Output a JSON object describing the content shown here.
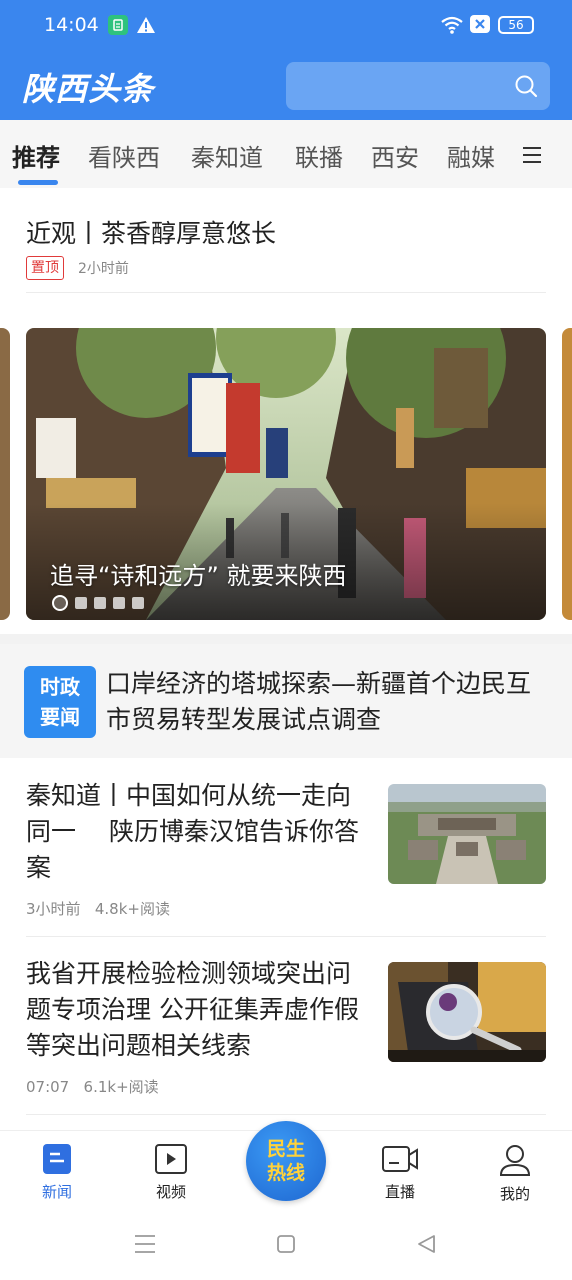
{
  "status_bar": {
    "time": "14:04",
    "battery": "56",
    "sim_label": "x"
  },
  "header": {
    "logo": "陕西头条",
    "search_placeholder": ""
  },
  "tabs": [
    {
      "label": "推荐",
      "active": true
    },
    {
      "label": "看陕西"
    },
    {
      "label": "秦知道"
    },
    {
      "label": "联播"
    },
    {
      "label": "西安"
    },
    {
      "label": "融媒"
    }
  ],
  "pinned": {
    "title": "近观丨茶香醇厚意悠长",
    "badge": "置顶",
    "time": "2小时前"
  },
  "carousel": {
    "caption": "追寻“诗和远方” 就要来陕西",
    "slide_count": 5,
    "active_index": 0
  },
  "headline": {
    "badge_line1": "时政",
    "badge_line2": "要闻",
    "title": "口岸经济的塔城探索—新疆首个边民互市贸易转型发展试点调查"
  },
  "articles": [
    {
      "title": "秦知道丨中国如何从统一走向同一　 陕历博秦汉馆告诉你答案",
      "time": "3小时前",
      "reads": "4.8k+阅读",
      "thumb": "palace-aerial"
    },
    {
      "title": "我省开展检验检测领域突出问题专项治理 公开征集弄虚作假等突出问题相关线索",
      "time": "07:07",
      "reads": "6.1k+阅读",
      "thumb": "magnifier-laptop"
    }
  ],
  "bottom_nav": {
    "news": "新闻",
    "video": "视频",
    "hotline_line1": "民生",
    "hotline_line2": "热线",
    "live": "直播",
    "mine": "我的"
  },
  "colors": {
    "brand_blue": "#3a86ee",
    "badge_red": "#e03a3a",
    "hotline_text": "#ffd23a"
  }
}
